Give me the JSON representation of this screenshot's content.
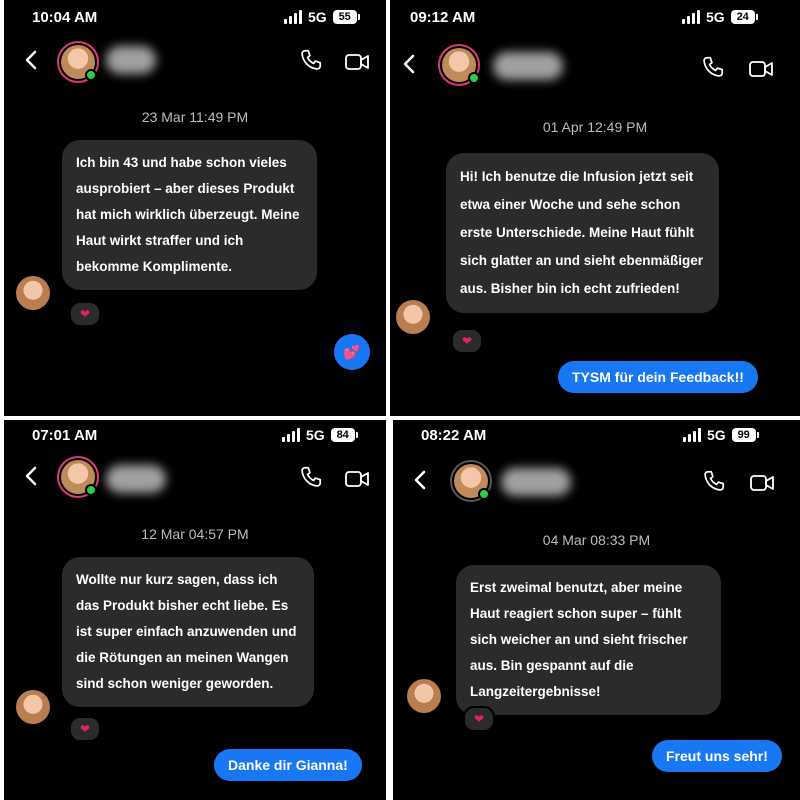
{
  "panels": [
    {
      "time": "10:04 AM",
      "network": "5G",
      "battery": "55",
      "timestamp": "23 Mar 11:49 PM",
      "received": "Ich bin 43 und habe schon vieles ausprobiert – aber dieses Produkt hat mich wirklich überzeugt. Meine Haut wirkt straffer und ich bekomme Komplimente.",
      "reaction": "❤",
      "sent": "",
      "sticker": "💕"
    },
    {
      "time": "09:12 AM",
      "network": "5G",
      "battery": "24",
      "timestamp": "01 Apr 12:49 PM",
      "received": "Hi! Ich benutze die Infusion jetzt seit etwa einer Woche und sehe schon erste Unterschiede. Meine Haut fühlt sich glatter an und sieht ebenmäßiger aus. Bisher bin ich echt zufrieden!",
      "reaction": "❤",
      "sent": "TYSM für dein Feedback!!"
    },
    {
      "time": "07:01 AM",
      "network": "5G",
      "battery": "84",
      "timestamp": "12 Mar 04:57 PM",
      "received": "Wollte nur kurz sagen, dass ich das Produkt bisher echt liebe. Es ist super einfach anzuwenden und die Rötungen an meinen Wangen sind schon weniger geworden.",
      "reaction": "❤",
      "sent": "Danke dir Gianna!"
    },
    {
      "time": "08:22 AM",
      "network": "5G",
      "battery": "99",
      "timestamp": "04 Mar 08:33 PM",
      "received": "Erst zweimal benutzt, aber meine Haut reagiert schon super – fühlt sich weicher an und sieht frischer aus. Bin gespannt auf die Langzeitergebnisse!",
      "reaction": "❤",
      "sent": "Freut uns sehr!"
    }
  ],
  "icons": [
    "back-icon",
    "phone-icon",
    "video-icon",
    "heart-icon",
    "signal-icon"
  ],
  "colors": {
    "sent_bubble": "#1877f2",
    "received_bubble": "#2b2b2b",
    "background": "#000000",
    "story_ring": "#d93a7a",
    "online": "#2ecc40"
  }
}
